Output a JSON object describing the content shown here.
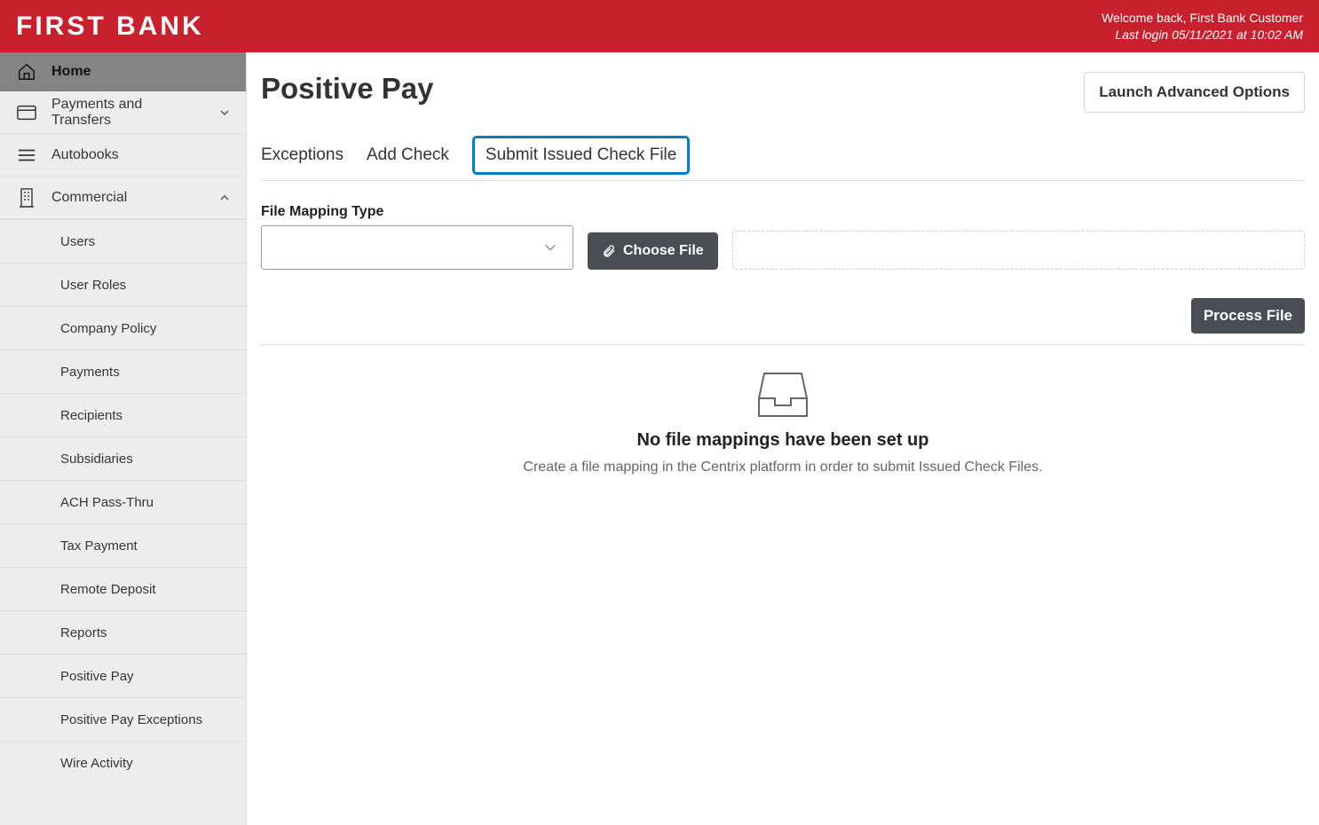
{
  "brand": "FIRST BANK",
  "header": {
    "welcome": "Welcome back, First Bank Customer",
    "lastLogin": "Last login 05/11/2021 at 10:02 AM"
  },
  "nav": {
    "home": "Home",
    "payments": "Payments and Transfers",
    "autobooks": "Autobooks",
    "commercial": "Commercial",
    "commercialItems": [
      "Users",
      "User Roles",
      "Company Policy",
      "Payments",
      "Recipients",
      "Subsidiaries",
      "ACH Pass-Thru",
      "Tax Payment",
      "Remote Deposit",
      "Reports",
      "Positive Pay",
      "Positive Pay Exceptions",
      "Wire Activity"
    ]
  },
  "page": {
    "title": "Positive Pay",
    "launch": "Launch Advanced Options",
    "tabs": {
      "exceptions": "Exceptions",
      "addCheck": "Add Check",
      "submit": "Submit Issued Check File"
    },
    "fieldLabel": "File Mapping Type",
    "chooseFile": "Choose File",
    "processFile": "Process File",
    "empty": {
      "title": "No file mappings have been set up",
      "sub": "Create a file mapping in the Centrix platform in order to submit Issued Check Files."
    }
  }
}
